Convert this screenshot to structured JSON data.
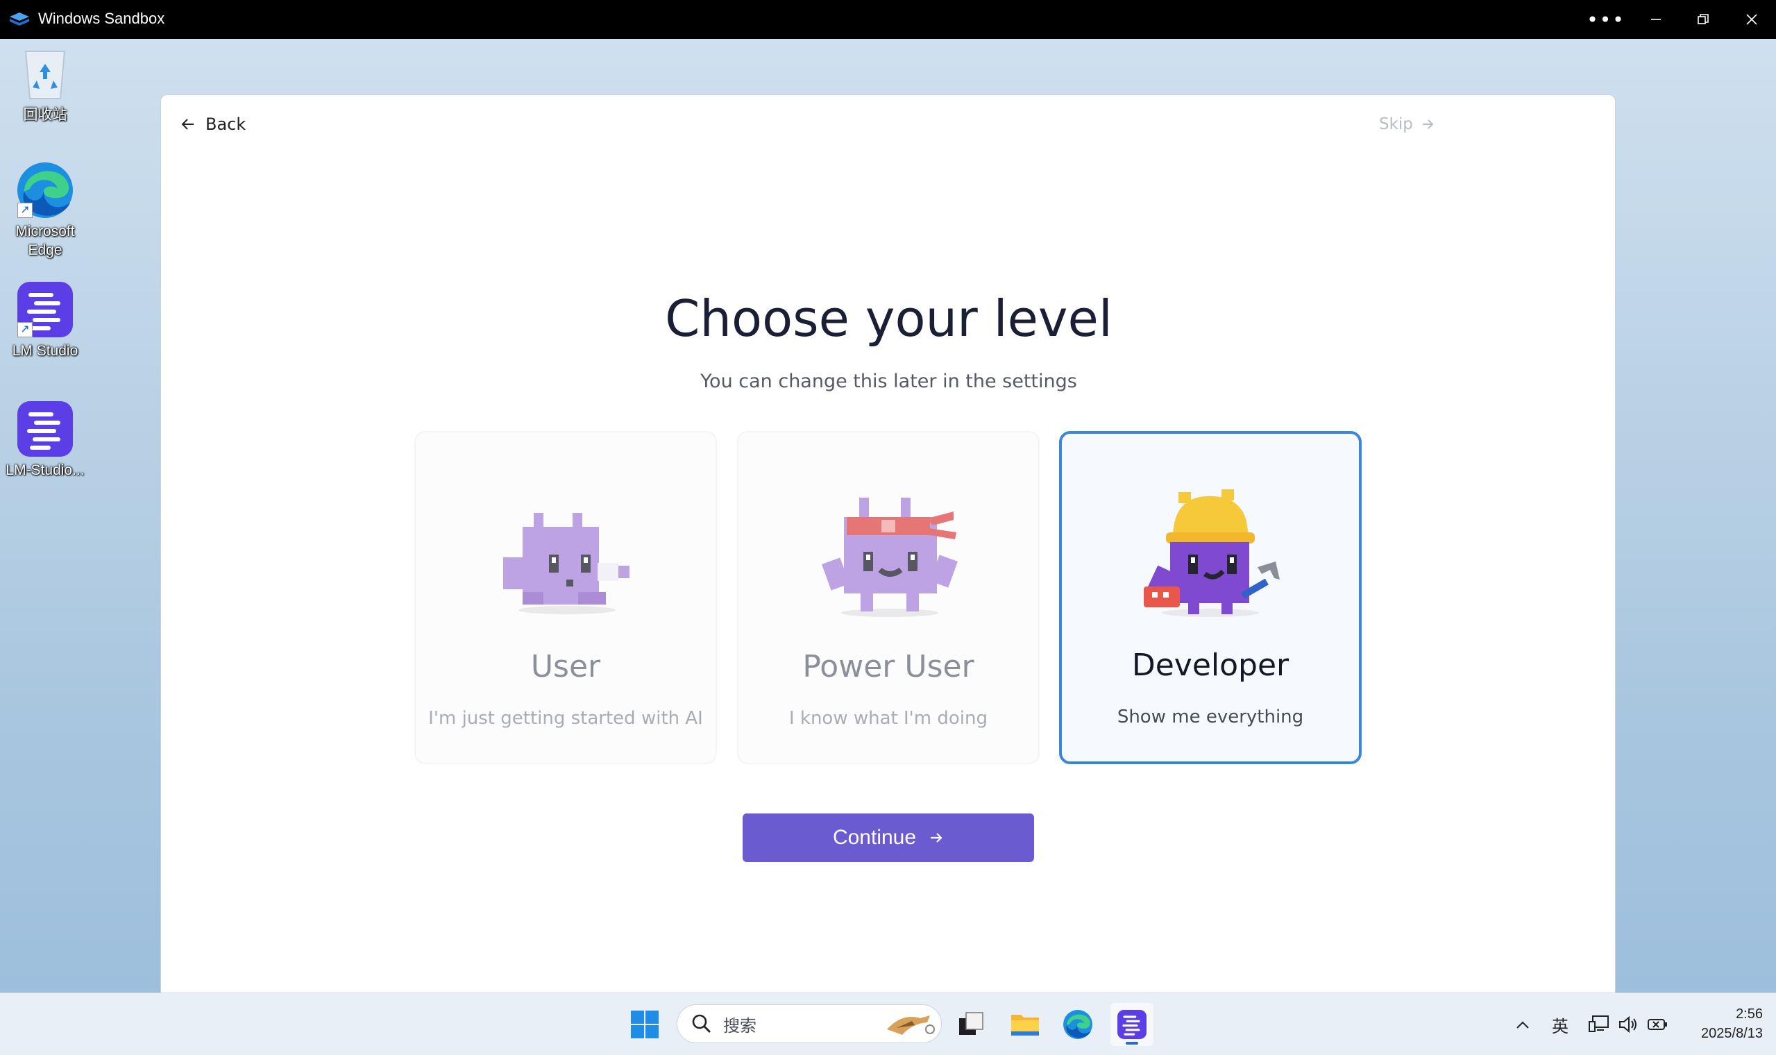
{
  "titlebar": {
    "title": "Windows Sandbox",
    "app_icon": "sandbox-icon",
    "controls": [
      "more-icon",
      "minimize-icon",
      "restore-icon",
      "close-icon"
    ]
  },
  "desktop": {
    "icons": [
      {
        "label": "回收站",
        "icon": "recycle-bin-icon"
      },
      {
        "label": "Microsoft Edge",
        "icon": "edge-icon"
      },
      {
        "label": "LM Studio",
        "icon": "lm-studio-icon"
      },
      {
        "label": "LM-Studio...",
        "icon": "lm-studio-installer-icon"
      }
    ]
  },
  "onboarding": {
    "back_label": "Back",
    "skip_label": "Skip",
    "title": "Choose your level",
    "subtitle": "You can change this later in the settings",
    "levels": [
      {
        "label": "User",
        "description": "I'm just getting started with AI",
        "selected": false
      },
      {
        "label": "Power User",
        "description": "I know what I'm doing",
        "selected": false
      },
      {
        "label": "Developer",
        "description": "Show me everything",
        "selected": true
      }
    ],
    "continue_label": "Continue",
    "colors": {
      "accent": "#6b5bd1",
      "selected_border": "#3d87d6",
      "mascot": "#9b6ad6"
    }
  },
  "taskbar": {
    "search_placeholder": "搜索",
    "apps": [
      "windows-start-icon",
      "search-icon",
      "task-view-icon",
      "file-explorer-icon",
      "edge-icon",
      "lm-studio-icon"
    ],
    "tray": {
      "ime": "英"
    },
    "clock": {
      "time": "2:56",
      "date": "2025/8/13"
    }
  }
}
